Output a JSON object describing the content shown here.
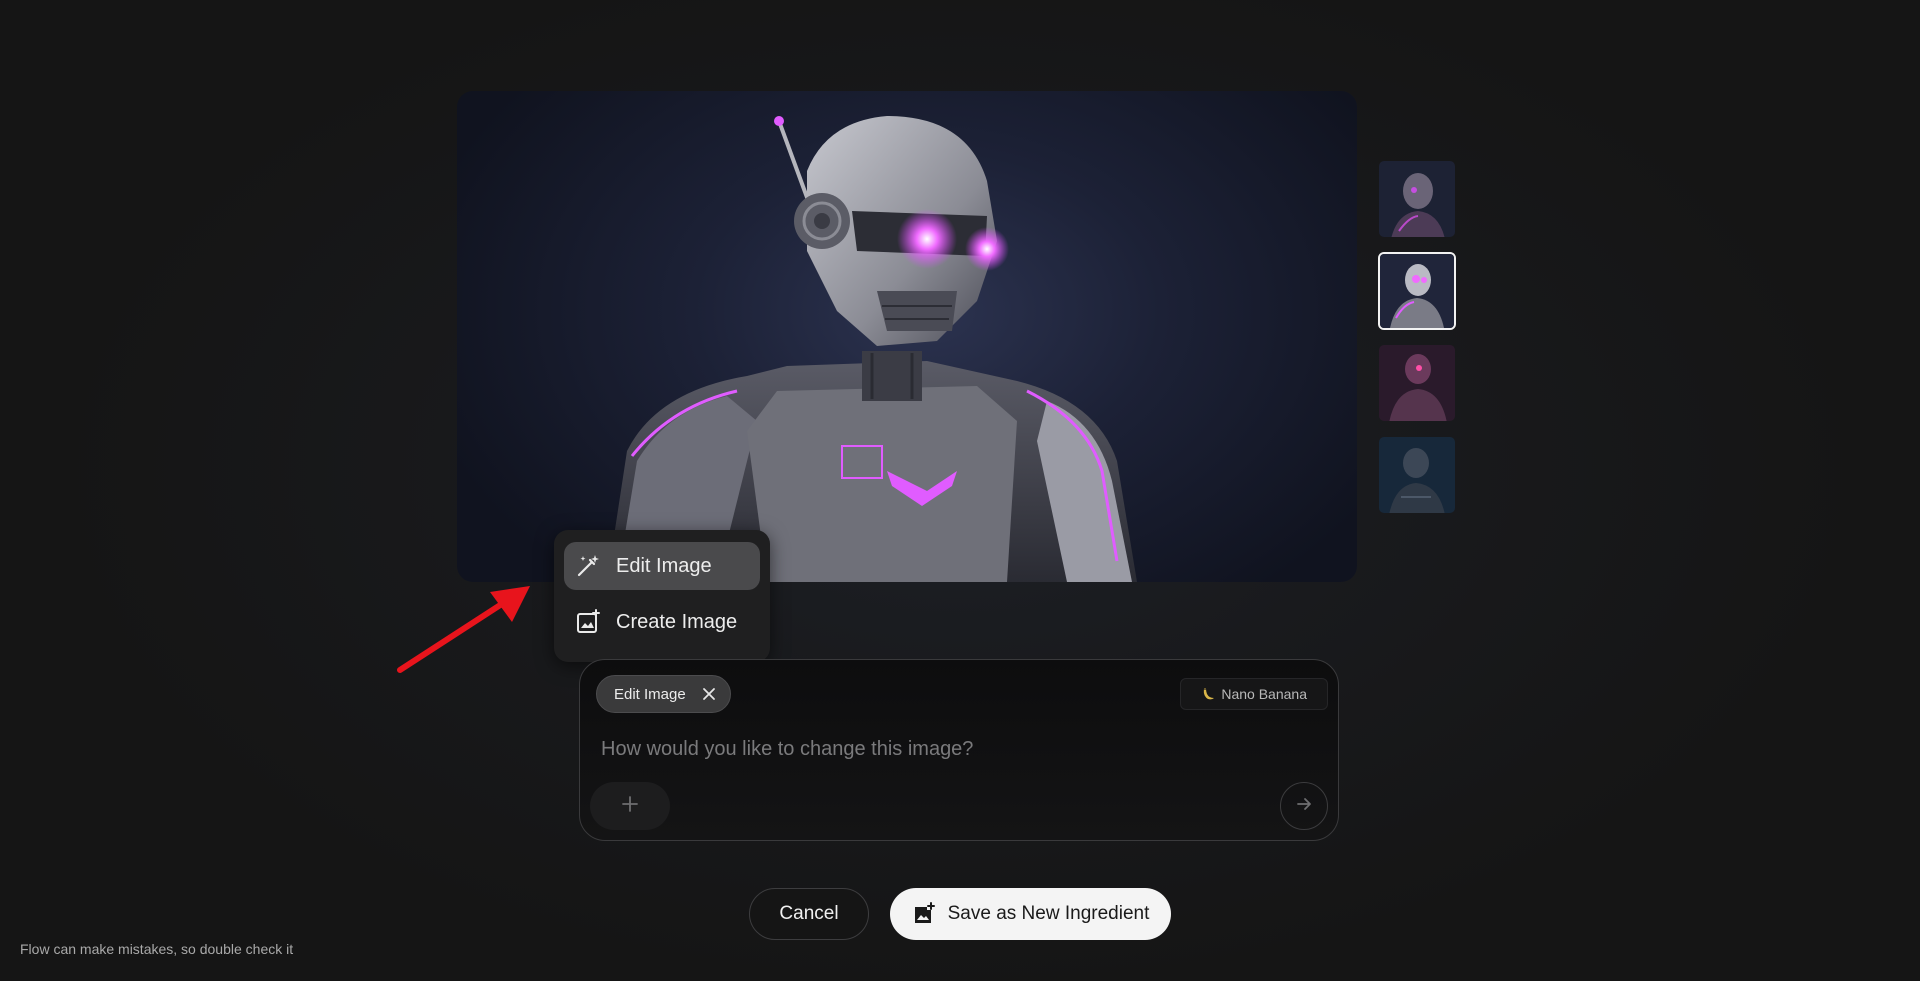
{
  "menu": {
    "items": [
      {
        "label": "Edit Image",
        "icon": "wand-icon",
        "active": true
      },
      {
        "label": "Create Image",
        "icon": "image-plus-icon",
        "active": false
      }
    ]
  },
  "prompt": {
    "chip_label": "Edit Image",
    "model_label": "Nano Banana",
    "placeholder": "How would you like to change this image?",
    "value": ""
  },
  "actions": {
    "cancel_label": "Cancel",
    "save_label": "Save as New Ingredient"
  },
  "footer": {
    "disclaimer": "Flow can make mistakes, so double check it"
  },
  "thumbnails": {
    "selected_index": 1,
    "count": 4
  },
  "colors": {
    "accent_magenta": "#d84bff",
    "annotation_arrow": "#e8141c",
    "background": "#161616"
  }
}
